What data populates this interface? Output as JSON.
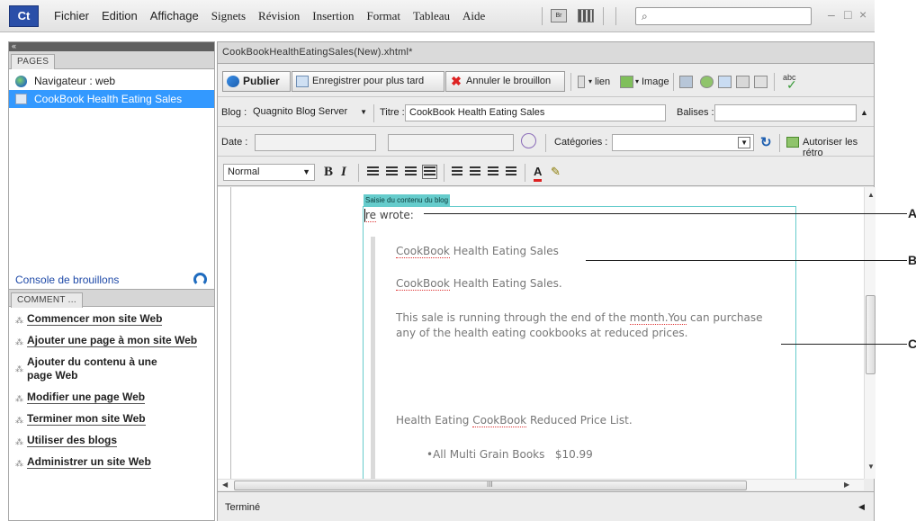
{
  "menubar": {
    "logo": "Ct",
    "items": [
      "Fichier",
      "Edition",
      "Affichage",
      "Signets",
      "Révision",
      "Insertion",
      "Format",
      "Tableau",
      "Aide"
    ],
    "br_icon": "Br",
    "search_icon": "search-icon",
    "window_controls": [
      "–",
      "□",
      "×"
    ]
  },
  "left_panel": {
    "collapse": "«",
    "pages_tab": "PAGES",
    "pages": [
      {
        "label": "Navigateur : web",
        "icon": "globe-icon",
        "selected": false
      },
      {
        "label": "CookBook Health Eating Sales",
        "icon": "document-icon",
        "selected": true
      }
    ],
    "console_link": "Console de brouillons",
    "how_tab": "COMMENT ...",
    "how_items": [
      "Commencer mon site Web",
      "Ajouter une page à mon site Web",
      "Ajouter du contenu à une page Web",
      "Modifier une page Web",
      "Terminer mon site Web",
      "Utiliser des blogs",
      "Administrer un site Web"
    ]
  },
  "document": {
    "tab_title": "CookBookHealthEatingSales(New).xhtml*",
    "toolbar": {
      "publish": "Publier",
      "save_later": "Enregistrer pour plus tard",
      "cancel_draft": "Annuler le brouillon",
      "link": "lien",
      "image": "Image",
      "spell": "abc"
    },
    "blog_label": "Blog :",
    "blog_value": "Quagnito Blog Server",
    "title_label": "Titre :",
    "title_value": "CookBook Health Eating Sales",
    "tags_label": "Balises :",
    "tags_value": "",
    "date_label": "Date :",
    "categories_label": "Catégories :",
    "allow_trackbacks": "Autoriser les rétro",
    "format_style": "Normal",
    "bold": "B",
    "italic": "I",
    "font_color": "A",
    "editor": {
      "region_tag": "Saisie du contenu du blog",
      "wrote_prefix": "re",
      "wrote_rest": " wrote:",
      "heading_word1": "CookBook",
      "heading_rest": " Health Eating Sales",
      "line2_word1": "CookBook",
      "line2_rest": " Health Eating Sales.",
      "paragraph_part1": "This sale is running through the end of the ",
      "paragraph_link": "month.You",
      "paragraph_part2": " can purchase any of the health eating cookbooks at reduced prices.",
      "list_title_part1": "Health Eating ",
      "list_title_word": "CookBook",
      "list_title_part2": " Reduced Price List.",
      "list_item": "•All Multi Grain Books   $10.99"
    },
    "hscroll_mark": "III",
    "status": "Terminé"
  },
  "callouts": [
    "A",
    "B",
    "C"
  ]
}
